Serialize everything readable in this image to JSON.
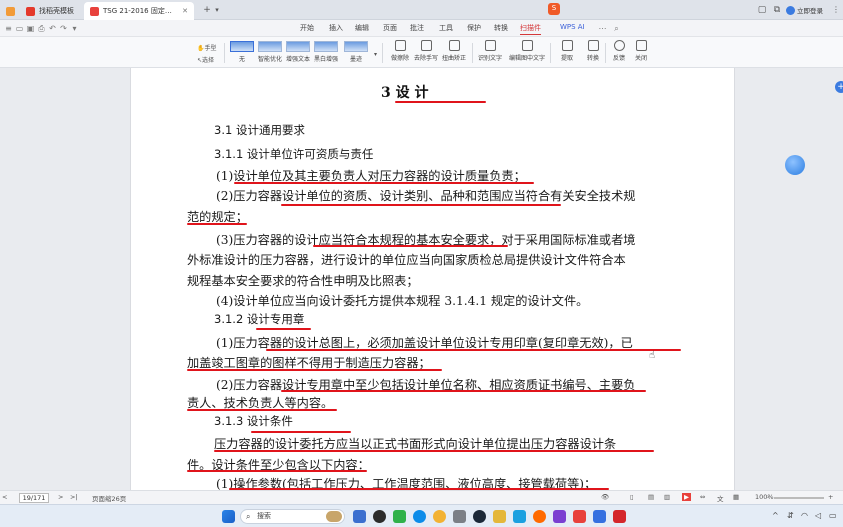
{
  "titlebar": {
    "tabs": [
      {
        "label": "",
        "icon": "sidebar-icon"
      },
      {
        "label": "找稻壳模板",
        "icon": "docer-icon"
      },
      {
        "label": "TSG 21-2016 固定式压力容器…",
        "icon": "pdf-icon"
      }
    ],
    "new_tab": "+",
    "new_tab_menu": "▾",
    "login_label": "立即登录"
  },
  "menubar": {
    "items": [
      "开始",
      "插入",
      "编辑",
      "页面",
      "批注",
      "工具",
      "保护",
      "转换",
      "扫描件",
      "WPS AI"
    ],
    "active": "扫描件"
  },
  "ribbon": {
    "hand_tool": "手型",
    "select_tool": "选择",
    "enhance_modes": [
      "无",
      "智能优化",
      "增强文本",
      "黑白增强",
      "墨迹"
    ],
    "buttons": [
      "做擦除",
      "去除手写",
      "扭曲矫正",
      "识别文字",
      "编辑图中文字",
      "提取",
      "转换",
      "反馈",
      "关闭"
    ]
  },
  "document": {
    "chapter_title": "3 设    计",
    "lines": [
      {
        "text": "3.1   设计通用要求",
        "type": "heading"
      },
      {
        "text": "3.1.1   设计单位许可资质与责任",
        "type": "heading"
      },
      {
        "text": "(1)设计单位及其主要负责人对压力容器的设计质量负责；",
        "type": "body"
      },
      {
        "text": "(2)压力容器设计单位的资质、设计类别、品种和范围应当符合有关安全技术规",
        "type": "body"
      },
      {
        "text": "范的规定；",
        "type": "body"
      },
      {
        "text": "(3)压力容器的设计应当符合本规程的基本安全要求，对于采用国际标准或者境",
        "type": "body"
      },
      {
        "text": "外标准设计的压力容器，进行设计的单位应当向国家质检总局提供设计文件符合本",
        "type": "body"
      },
      {
        "text": "规程基本安全要求的符合性申明及比照表；",
        "type": "body"
      },
      {
        "text": "(4)设计单位应当向设计委托方提供本规程 3.1.4.1 规定的设计文件。",
        "type": "body"
      },
      {
        "text": "3.1.2   设计专用章",
        "type": "heading"
      },
      {
        "text": "(1)压力容器的设计总图上，必须加盖设计单位设计专用印章(复印章无效)，已",
        "type": "body"
      },
      {
        "text": "加盖竣工图章的图样不得用于制造压力容器；",
        "type": "body"
      },
      {
        "text": "(2)压力容器设计专用章中至少包括设计单位名称、相应资质证书编号、主要负",
        "type": "body"
      },
      {
        "text": "责人、技术负责人等内容。",
        "type": "body"
      },
      {
        "text": "3.1.3   设计条件",
        "type": "heading"
      },
      {
        "text": "压力容器的设计委托方应当以正式书面形式向设计单位提出压力容器设计条",
        "type": "body"
      },
      {
        "text": "件。设计条件至少包含以下内容：",
        "type": "body"
      },
      {
        "text": "(1)操作参数(包括工作压力、工作温度范围、液位高度、接管载荷等)；",
        "type": "body"
      }
    ]
  },
  "statusbar": {
    "page_indicator": "19/171",
    "page_label": "页面缩26页",
    "zoom": "100%",
    "zoom_minus": "-",
    "zoom_plus": "+"
  },
  "taskbar": {
    "search_placeholder": "搜索"
  },
  "colors": {
    "accent": "#d4383a",
    "underline": "#e0141b",
    "page_bg": "#ffffff",
    "workspace_bg": "#e9ebef"
  }
}
